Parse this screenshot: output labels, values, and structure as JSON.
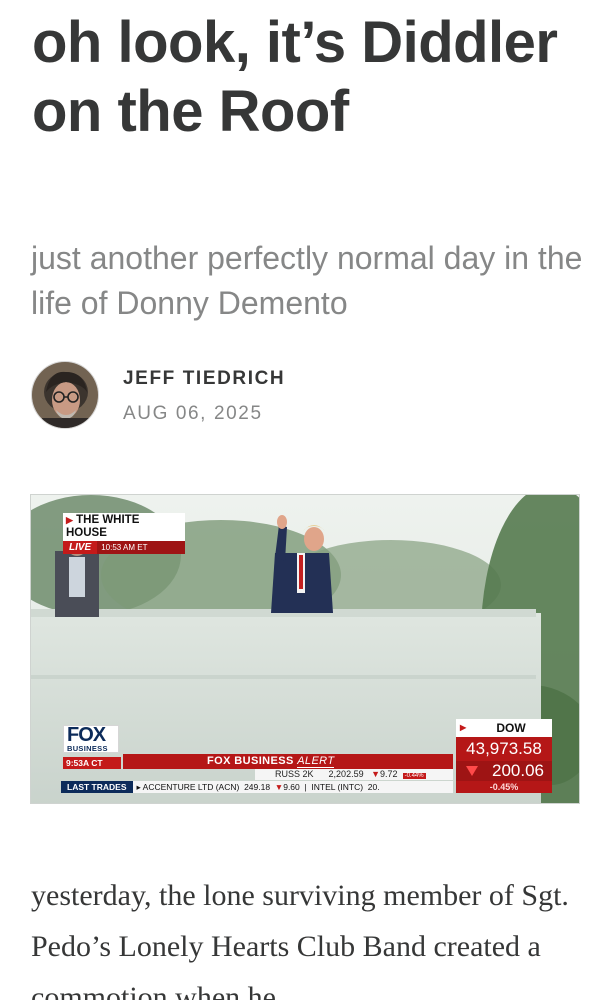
{
  "post": {
    "title": "oh look, it’s Diddler on the Roof",
    "subtitle": "just another perfectly normal day in the life of Donny Demento",
    "author": "JEFF TIEDRICH",
    "date": "AUG 06, 2025",
    "body": "yesterday, the lone surviving member of Sgt. Pedo’s Lonely Hearts Club Band created a commotion when he"
  },
  "video": {
    "locator": "THE WHITE HOUSE",
    "live": "LIVE",
    "live_time": "10:53 AM ET",
    "network_word": "FOX",
    "network_sub": "BUSINESS",
    "ticker_time": "9:53A CT",
    "alert_brand": "FOX BUSINESS",
    "alert_tag": "ALERT",
    "russ_label": "RUSS 2K",
    "russ_value": "2,202.59",
    "russ_change": "9.72",
    "russ_pct": "-0.44%",
    "last_trades_label": "LAST TRADES",
    "trade1_name": "ACCENTURE LTD (ACN)",
    "trade1_price": "249.18",
    "trade1_change": "9.60",
    "trade2_name": "INTEL (INTC)",
    "trade2_price": "20.",
    "dow_label": "DOW",
    "dow_value": "43,973.58",
    "dow_change": "200.06",
    "dow_pct": "-0.45%"
  },
  "colors": {
    "title_text": "#363737",
    "muted_text": "#868787",
    "fox_red": "#c41a1a",
    "fox_navy": "#0c2b5a"
  },
  "icons": {
    "avatar": "author-portrait",
    "locator_arrow": "play-arrow-icon",
    "dow_arrow": "down-triangle-icon"
  }
}
